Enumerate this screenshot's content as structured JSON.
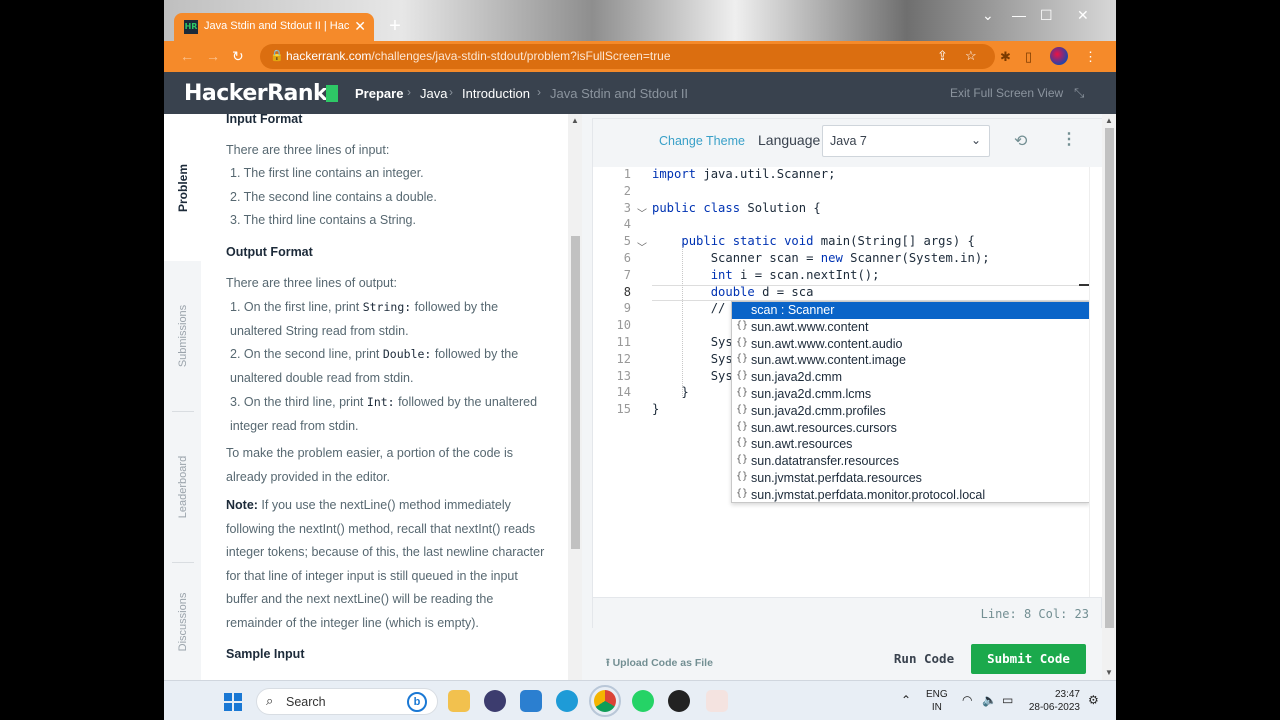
{
  "browser": {
    "tab_title": "Java Stdin and Stdout II | HackerRank",
    "tab_favicon": "HR",
    "url_domain": "hackerrank.com",
    "url_path": "/challenges/java-stdin-stdout/problem?isFullScreen=true"
  },
  "header": {
    "logo": "HackerRank",
    "breadcrumbs": [
      "Prepare",
      "Java",
      "Introduction",
      "Java Stdin and Stdout II"
    ],
    "exit_fullscreen": "Exit Full Screen View"
  },
  "left_tabs": [
    "Problem",
    "Submissions",
    "Leaderboard",
    "Discussions"
  ],
  "problem": {
    "input_format_heading": "Input Format",
    "input_intro": "There are three lines of input:",
    "input_items": [
      "1. The first line contains an integer.",
      "2. The second line contains a double.",
      "3. The third line contains a String."
    ],
    "output_format_heading": "Output Format",
    "output_intro": "There are three lines of output:",
    "output_items": [
      {
        "pre": "1. On the first line, print ",
        "code": "String:",
        "post": " followed by the unaltered String read from stdin."
      },
      {
        "pre": "2. On the second line, print ",
        "code": "Double:",
        "post": " followed by the unaltered double read from stdin."
      },
      {
        "pre": "3. On the third line, print ",
        "code": "Int:",
        "post": " followed by the unaltered integer read from stdin."
      }
    ],
    "hint": "To make the problem easier, a portion of the code is already provided in the editor.",
    "note_label": "Note:",
    "note_text": " If you use the nextLine() method immediately following the nextInt() method, recall that nextInt() reads integer tokens; because of this, the last newline character for that line of integer input is still queued in the input buffer and the next nextLine() will be reading the remainder of the integer line (which is empty).",
    "sample_input_heading": "Sample Input"
  },
  "editor": {
    "change_theme": "Change Theme",
    "language_label": "Language",
    "language_value": "Java 7",
    "code_lines": [
      {
        "n": "1",
        "html": "<span class='kw'>import</span> java.util.Scanner;"
      },
      {
        "n": "2",
        "html": ""
      },
      {
        "n": "3",
        "html": "<span class='kw'>public class</span> Solution {"
      },
      {
        "n": "4",
        "html": ""
      },
      {
        "n": "5",
        "html": "    <span class='kw'>public static void</span> main(String[] args) {"
      },
      {
        "n": "6",
        "html": "        Scanner scan = <span class='kw'>new</span> Scanner(System.in);"
      },
      {
        "n": "7",
        "html": "        <span class='kw'>int</span> i = scan.nextInt();"
      },
      {
        "n": "8",
        "html": "        <span class='kw'>double</span> d = sca"
      },
      {
        "n": "9",
        "html": "        //"
      },
      {
        "n": "10",
        "html": ""
      },
      {
        "n": "11",
        "html": "        Sys"
      },
      {
        "n": "12",
        "html": "        Sys"
      },
      {
        "n": "13",
        "html": "        Sys"
      },
      {
        "n": "14",
        "html": "    }"
      },
      {
        "n": "15",
        "html": "}"
      }
    ],
    "autocomplete": [
      "scan : Scanner",
      "sun.awt.www.content",
      "sun.awt.www.content.audio",
      "sun.awt.www.content.image",
      "sun.java2d.cmm",
      "sun.java2d.cmm.lcms",
      "sun.java2d.cmm.profiles",
      "sun.awt.resources.cursors",
      "sun.awt.resources",
      "sun.datatransfer.resources",
      "sun.jvmstat.perfdata.resources",
      "sun.jvmstat.perfdata.monitor.protocol.local"
    ],
    "status": "Line: 8 Col: 23",
    "upload": "Upload Code as File",
    "run": "Run Code",
    "submit": "Submit Code"
  },
  "taskbar": {
    "search": "Search",
    "lang_top": "ENG",
    "lang_bottom": "IN",
    "time": "23:47",
    "date": "28-06-2023"
  },
  "colors": {
    "brand_orange": "#f58a2a",
    "hr_dark": "#39424e",
    "hr_green": "#1ba94c",
    "selection_blue": "#0a64c8"
  }
}
